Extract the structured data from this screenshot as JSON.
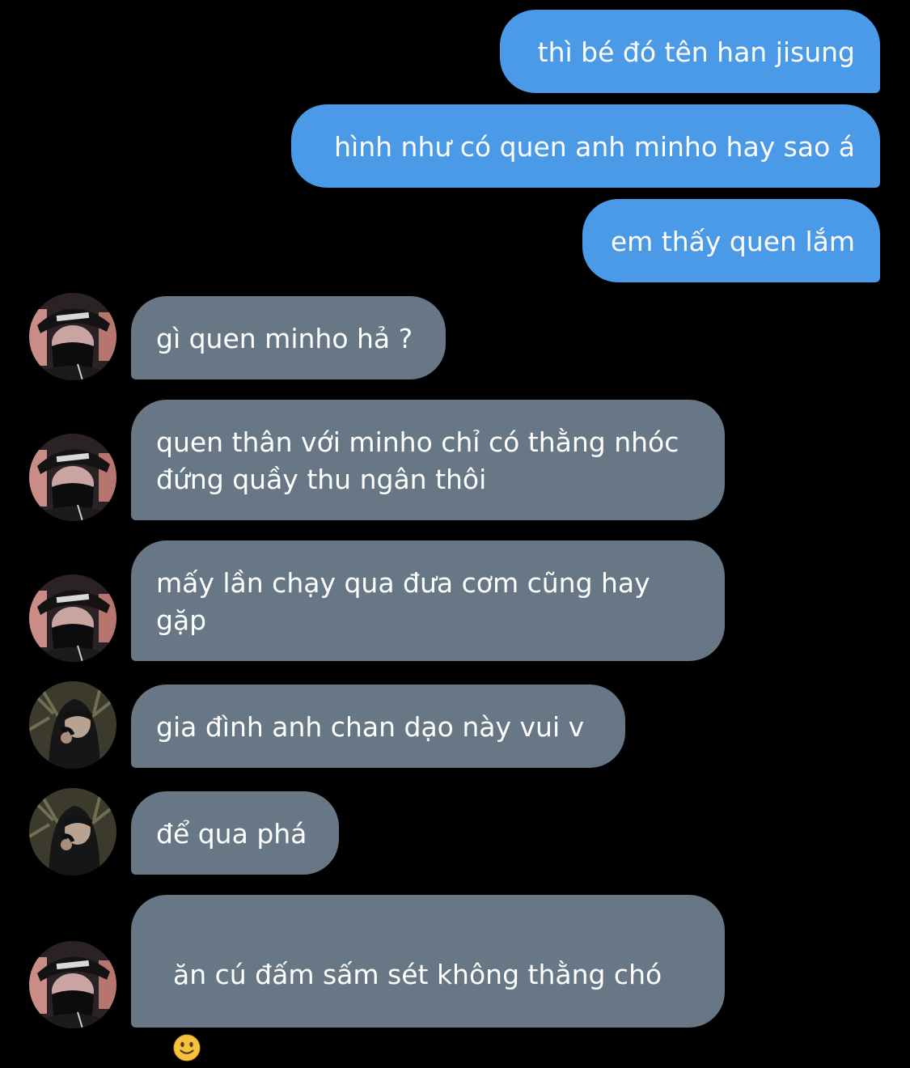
{
  "conversation": {
    "outgoing": [
      {
        "text": "thì bé đó tên han jisung"
      },
      {
        "text": "hình như có quen anh minho hay sao á"
      },
      {
        "text": "em thấy quen lắm"
      }
    ],
    "incoming": [
      {
        "text": "gì quen minho hả ?",
        "avatar": "avatar-masked-cap-photo"
      },
      {
        "text": "quen thân với minho chỉ có thằng nhóc\nđứng quầy thu ngân thôi",
        "avatar": "avatar-masked-cap-photo"
      },
      {
        "text": "mấy lần chạy qua đưa cơm cũng hay\ngặp",
        "avatar": "avatar-masked-cap-photo"
      },
      {
        "text": "gia đình anh chan dạo này vui v",
        "avatar": "avatar-hooded-plants-photo"
      },
      {
        "text": "để qua phá",
        "avatar": "avatar-hooded-plants-photo"
      },
      {
        "text": "ăn cú đấm sấm sét không thằng chó",
        "emoji": "slightly-smiling-face-emoji",
        "avatar": "avatar-masked-cap-photo"
      }
    ]
  },
  "colors": {
    "background": "#000000",
    "outgoing_bubble": "#4a9ae8",
    "incoming_bubble": "#687785",
    "text": "#ffffff"
  }
}
